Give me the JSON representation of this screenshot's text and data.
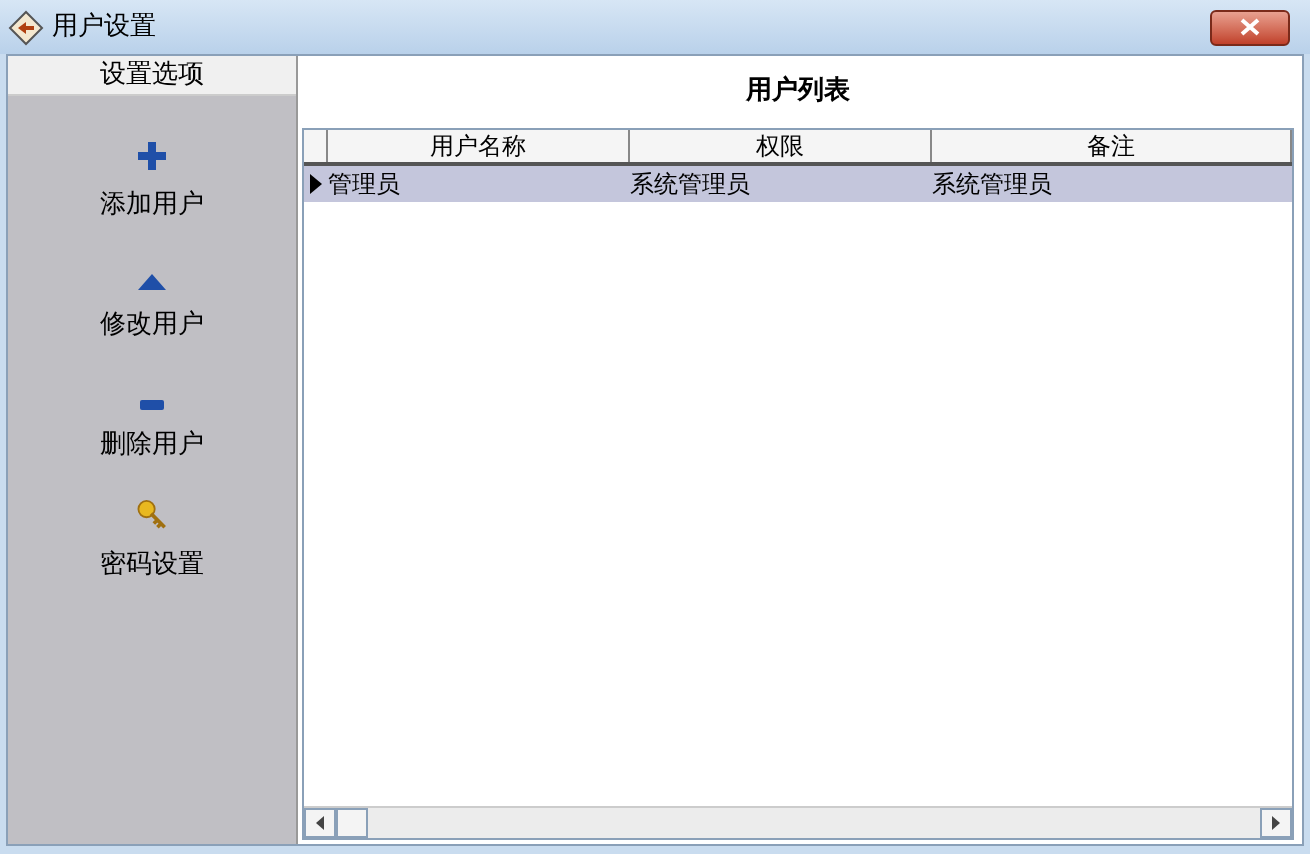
{
  "window": {
    "title": "用户设置"
  },
  "sidebar": {
    "header": "设置选项",
    "items": [
      {
        "label": "添加用户",
        "kind": "plus"
      },
      {
        "label": "修改用户",
        "kind": "triangle"
      },
      {
        "label": "删除用户",
        "kind": "minus"
      },
      {
        "label": "密码设置",
        "kind": "key"
      }
    ]
  },
  "panel": {
    "title": "用户列表"
  },
  "table": {
    "columns": [
      "用户名称",
      "权限",
      "备注"
    ],
    "rows": [
      {
        "cells": [
          "管理员",
          "系统管理员",
          "系统管理员"
        ],
        "selected": true
      }
    ]
  }
}
